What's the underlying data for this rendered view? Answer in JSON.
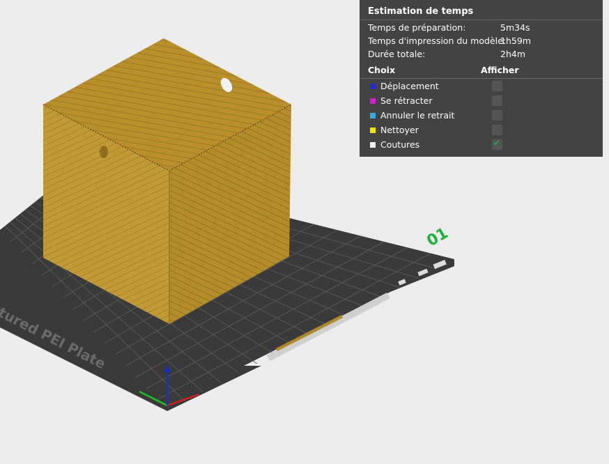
{
  "scene": {
    "plate_label": "tured PEI Plate",
    "plate_number": "01",
    "colors": {
      "background": "#ececec",
      "plate": "#3a3a3a",
      "grid": "#5a5a5a",
      "model_light": "#c19a36",
      "model_dark": "#9c7820",
      "model_top": "#b8902c",
      "axis_x": "#d42020",
      "axis_y": "#22c02a",
      "axis_z": "#1a2fc0",
      "plate_number": "#1fb23a"
    }
  },
  "panel": {
    "title": "Estimation de temps",
    "rows": [
      {
        "label": "Temps de préparation:",
        "value": "5m34s"
      },
      {
        "label": "Temps d'impression du modèle:",
        "value": "1h59m"
      },
      {
        "label": "Durée totale:",
        "value": "2h4m"
      }
    ],
    "col_choice": "Choix",
    "col_show": "Afficher",
    "legend": [
      {
        "label": "Déplacement",
        "color": "#2a2ac8",
        "checked": false
      },
      {
        "label": "Se rétracter",
        "color": "#d21fd2",
        "checked": false
      },
      {
        "label": "Annuler le retrait",
        "color": "#3aa8d8",
        "checked": false
      },
      {
        "label": "Nettoyer",
        "color": "#f2e600",
        "checked": false
      },
      {
        "label": "Coutures",
        "color": "#f0f0f0",
        "checked": true
      }
    ],
    "check_mark": "✔"
  }
}
